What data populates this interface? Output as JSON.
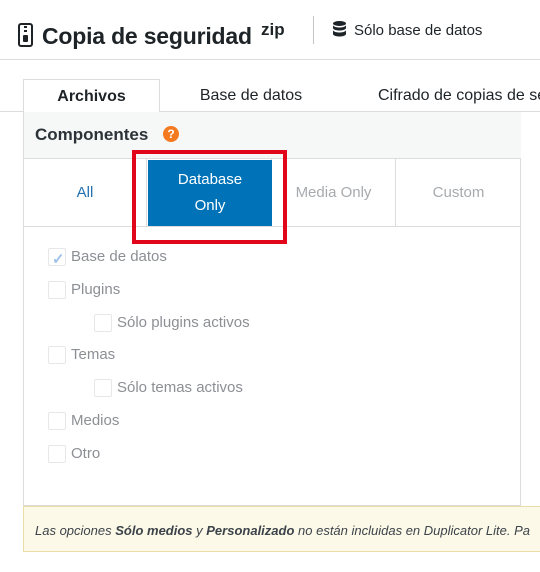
{
  "header": {
    "title": "Copia de seguridad",
    "format_badge": "zip",
    "scope_label": "Sólo base de datos"
  },
  "tabs": [
    {
      "label": "Archivos",
      "active": true
    },
    {
      "label": "Base de datos",
      "active": false
    },
    {
      "label": "Cifrado de copias de se",
      "active": false
    }
  ],
  "components": {
    "title": "Componentes",
    "help_glyph": "?",
    "modes": [
      {
        "label": "All"
      },
      {
        "label": "Database Only",
        "selected": true
      },
      {
        "label": "Media Only"
      },
      {
        "label": "Custom"
      }
    ],
    "options": [
      {
        "label": "Base de datos",
        "checked": true
      },
      {
        "label": "Plugins",
        "checked": false
      },
      {
        "label": "Sólo plugins activos",
        "checked": false
      },
      {
        "label": "Temas",
        "checked": false
      },
      {
        "label": "Sólo temas activos",
        "checked": false
      },
      {
        "label": "Medios",
        "checked": false
      },
      {
        "label": "Otro",
        "checked": false
      }
    ]
  },
  "notice": {
    "prefix": "Las opciones ",
    "media_only": "Sólo medios",
    "and": " y ",
    "custom": "Personalizado",
    "suffix": " no están incluidas en Duplicator Lite. Pa"
  },
  "colors": {
    "accent": "#0073b8",
    "link": "#2271b1",
    "highlight": "#e2061b",
    "help": "#f37a1f"
  }
}
